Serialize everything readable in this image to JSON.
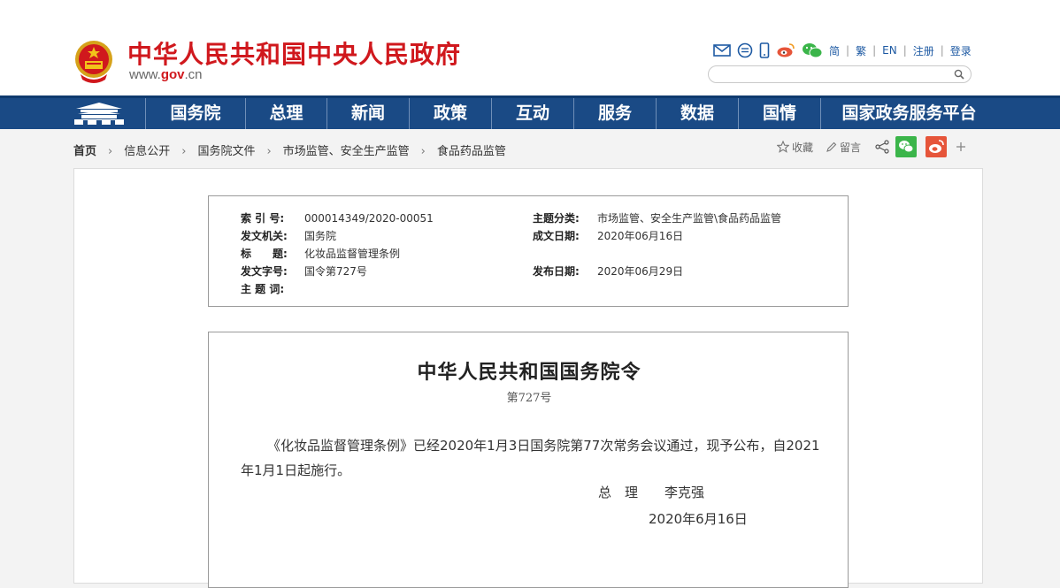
{
  "header": {
    "site_title": "中华人民共和国中央人民政府",
    "site_url_prefix": "www.",
    "site_url_brand": "gov",
    "site_url_suffix": ".cn",
    "util_links": [
      "简",
      "繁",
      "EN",
      "注册",
      "登录"
    ],
    "search": {
      "placeholder": "",
      "value": ""
    }
  },
  "nav": {
    "items": [
      "国务院",
      "总理",
      "新闻",
      "政策",
      "互动",
      "服务",
      "数据",
      "国情",
      "国家政务服务平台"
    ]
  },
  "breadcrumb": {
    "items": [
      "首页",
      "信息公开",
      "国务院文件",
      "市场监管、安全生产监管",
      "食品药品监管"
    ]
  },
  "toolbar": {
    "favorite": "收藏",
    "comment": "留言"
  },
  "meta": {
    "index_label": "索 引 号:",
    "index_value": "000014349/2020-00051",
    "topic_label": "主题分类:",
    "topic_value": "市场监管、安全生产监管\\食品药品监管",
    "issuer_label": "发文机关:",
    "issuer_value": "国务院",
    "written_date_label": "成文日期:",
    "written_date_value": "2020年06月16日",
    "title_label": "标　　题:",
    "title_value": "化妆品监督管理条例",
    "doc_number_label": "发文字号:",
    "doc_number_value": "国令第727号",
    "publish_date_label": "发布日期:",
    "publish_date_value": "2020年06月29日",
    "keywords_label": "主 题 词:",
    "keywords_value": ""
  },
  "document": {
    "title": "中华人民共和国国务院令",
    "number": "第727号",
    "body": "《化妆品监督管理条例》已经2020年1月3日国务院第77次常务会议通过，现予公布，自2021年1月1日起施行。",
    "signature": "总　理　　李克强",
    "date": "2020年6月16日"
  },
  "colors": {
    "brand_red": "#d0181d",
    "nav_blue": "#1a4a85",
    "link_blue": "#1e5aa3",
    "wechat_green": "#3bb54a",
    "weibo_red": "#e6553a"
  }
}
